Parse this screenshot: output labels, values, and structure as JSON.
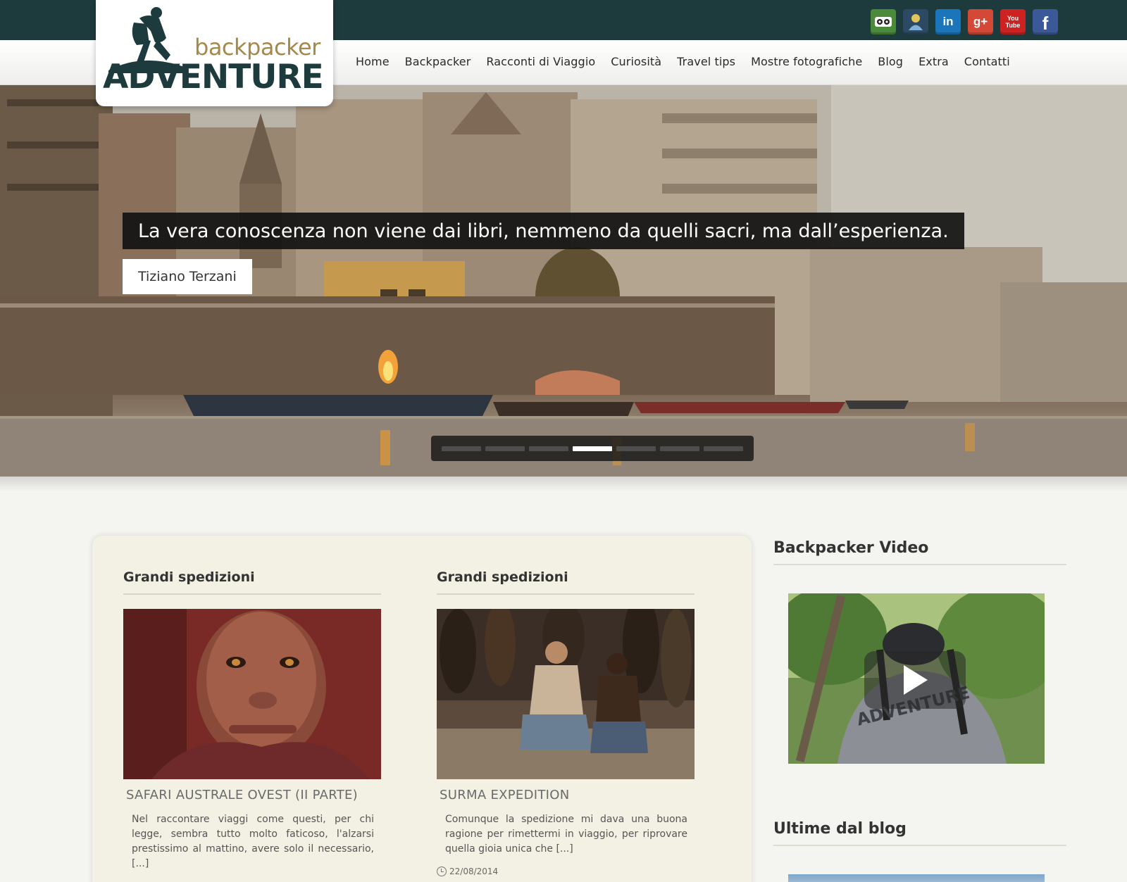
{
  "logo": {
    "line1": "backpacker",
    "line2": "ADVENTURE"
  },
  "social": [
    {
      "icon": "tripadvisor-icon",
      "label": "",
      "color": "#4a8a3a"
    },
    {
      "icon": "profile-badge-icon",
      "label": "",
      "color": "#2c4a63"
    },
    {
      "icon": "linkedin-icon",
      "label": "in",
      "color": "#1b75bb"
    },
    {
      "icon": "google-plus-icon",
      "label": "g+",
      "color": "#d34836"
    },
    {
      "icon": "youtube-icon",
      "label": "You Tube",
      "color": "#cc2222"
    },
    {
      "icon": "facebook-icon",
      "label": "f",
      "color": "#3b5998"
    }
  ],
  "nav": {
    "items": [
      {
        "label": "Home",
        "name": "nav-home"
      },
      {
        "label": "Backpacker",
        "name": "nav-backpacker"
      },
      {
        "label": "Racconti di Viaggio",
        "name": "nav-racconti-di-viaggio"
      },
      {
        "label": "Curiosità",
        "name": "nav-curiosita"
      },
      {
        "label": "Travel tips",
        "name": "nav-travel-tips"
      },
      {
        "label": "Mostre fotografiche",
        "name": "nav-mostre-fotografiche"
      },
      {
        "label": "Blog",
        "name": "nav-blog"
      },
      {
        "label": "Extra",
        "name": "nav-extra"
      },
      {
        "label": "Contatti",
        "name": "nav-contatti"
      }
    ]
  },
  "hero": {
    "quote": "La vera conoscenza non viene dai libri, nemmeno da quelli sacri, ma dall’esperienza.",
    "author": "Tiziano Terzani",
    "slides_total": 7,
    "active_slide": 4
  },
  "posts": [
    {
      "category": "Grandi spedizioni",
      "title": "SAFARI AUSTRALE OVEST (II PARTE)",
      "excerpt": "Nel raccontare viaggi come questi, per chi legge, sembra tutto molto faticoso, l'alzarsi prestissimo al mattino, avere solo il necessario, [...]",
      "date": ""
    },
    {
      "category": "Grandi spedizioni",
      "title": "SURMA EXPEDITION",
      "excerpt": "Comunque la spedizione mi dava una buona ragione per rimettermi in viaggio, per riprovare quella gioia unica che [...]",
      "date": "22/08/2014"
    }
  ],
  "sidebar": {
    "video_title": "Backpacker Video",
    "video_logo_text": "ADVENTURE",
    "blog_title": "Ultime dal blog"
  },
  "colors": {
    "topbar": "#1d3a3c",
    "logo_gold": "#a6884a",
    "panel": "#f3f1e3"
  }
}
